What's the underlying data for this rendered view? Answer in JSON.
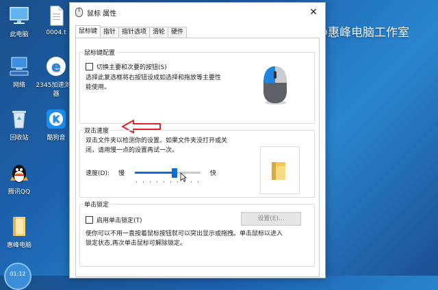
{
  "desktop": {
    "icons": [
      {
        "label": "此电脑"
      },
      {
        "label": "0004.t"
      },
      {
        "label": "网络"
      },
      {
        "label": "2345加速浏览器"
      },
      {
        "label": "回收站"
      },
      {
        "label": "酷狗音"
      },
      {
        "label": "腾讯QQ"
      },
      {
        "label": "惠峰电脑"
      }
    ],
    "watermark": "@惠峰电脑工作室",
    "clock": "01:12"
  },
  "dialog": {
    "title": "鼠标 属性",
    "close_glyph": "✕",
    "tabs": [
      {
        "label": "鼠标键",
        "active": true
      },
      {
        "label": "指针"
      },
      {
        "label": "指针选项"
      },
      {
        "label": "滑轮"
      },
      {
        "label": "硬件"
      }
    ],
    "button_config": {
      "title": "鼠标键配置",
      "checkbox_label": "切换主要和次要的按钮(S)",
      "checked": false,
      "description_line1": "选择此复选框将右按钮设成如选择和拖放等主要性",
      "description_line2": "能使用。"
    },
    "double_click": {
      "title": "双击速度",
      "description_line1": "双击文件夹以检测你的设置。如果文件夹没打开或关",
      "description_line2": "闭，请用慢一点的设置再试一次。",
      "speed_label": "速度(D):",
      "slow_label": "慢",
      "fast_label": "快",
      "speed_value_fraction": 0.6
    },
    "click_lock": {
      "title": "单击锁定",
      "checkbox_label": "启用单击锁定(T)",
      "checked": false,
      "settings_button": "设置(E)...",
      "description_line1": "使你可以不用一直按着鼠标按钮就可以突出显示或拖拽。单击鼠标以进入",
      "description_line2": "锁定状态,再次单击鼠标可解除锁定。"
    }
  },
  "colors": {
    "accent": "#0a6fd1",
    "annotation_arrow": "#e0202a"
  }
}
